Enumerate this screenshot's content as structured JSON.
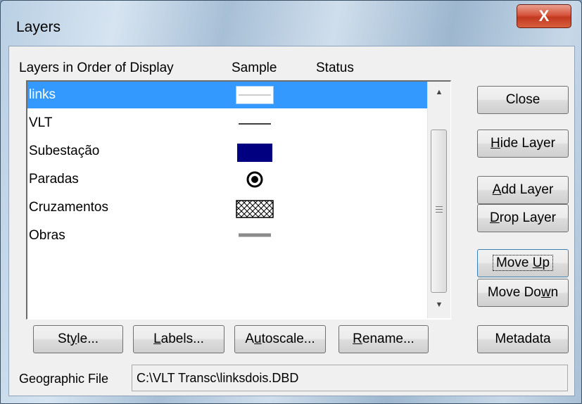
{
  "window": {
    "title": "Layers",
    "close_glyph": "X"
  },
  "columns": {
    "name": "Layers in Order of Display",
    "sample": "Sample",
    "status": "Status"
  },
  "layers": [
    {
      "label": "links",
      "selected": true,
      "sample_icon": "thin-line-white"
    },
    {
      "label": "VLT",
      "selected": false,
      "sample_icon": "thin-line-black"
    },
    {
      "label": "Subestação",
      "selected": false,
      "sample_icon": "navy-fill"
    },
    {
      "label": "Paradas",
      "selected": false,
      "sample_icon": "bullseye-point"
    },
    {
      "label": "Cruzamentos",
      "selected": false,
      "sample_icon": "crosshatch-fill"
    },
    {
      "label": "Obras",
      "selected": false,
      "sample_icon": "thick-gray-line"
    }
  ],
  "colors": {
    "selection": "#3399ff",
    "navy": "#000080",
    "gray_line": "#8c8c8c"
  },
  "buttons": {
    "close": "Close",
    "hide_layer": {
      "u": "H",
      "rest": "ide Layer"
    },
    "add_layer": {
      "u": "A",
      "rest": "dd Layer"
    },
    "drop_layer": {
      "u": "D",
      "rest": "rop Layer"
    },
    "move_up": {
      "pre": "Move ",
      "u": "U",
      "rest": "p"
    },
    "move_down": {
      "pre": "Move Do",
      "u": "w",
      "rest": "n"
    },
    "metadata": "Metadata",
    "style": {
      "pre": "St",
      "u": "y",
      "rest": "le..."
    },
    "labels": {
      "u": "L",
      "rest": "abels..."
    },
    "autoscale": {
      "pre": "A",
      "u": "u",
      "rest": "toscale..."
    },
    "rename": {
      "u": "R",
      "rest": "ename..."
    }
  },
  "geographic_file": {
    "label": "Geographic File",
    "value": "C:\\VLT Transc\\linksdois.DBD"
  }
}
